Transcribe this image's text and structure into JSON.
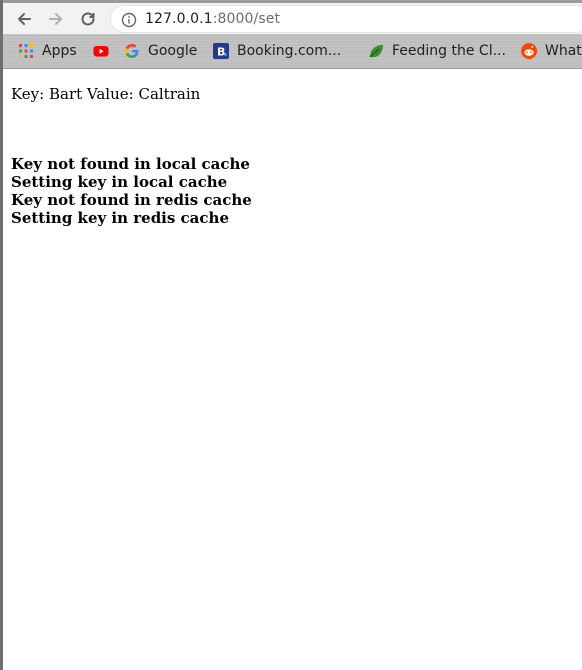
{
  "browser": {
    "url_host": "127.0.0.1",
    "url_rest": ":8000/set"
  },
  "bookmarks": [
    {
      "label": "Apps",
      "icon": "apps-grid-icon"
    },
    {
      "label": "",
      "icon": "youtube-icon"
    },
    {
      "label": "Google",
      "icon": "google-icon"
    },
    {
      "label": "Booking.com...",
      "icon": "booking-icon"
    },
    {
      "label": "Feeding the Cl...",
      "icon": "leaf-icon"
    },
    {
      "label": "What",
      "icon": "reddit-icon"
    }
  ],
  "page": {
    "key_value_line": "Key: Bart Value: Caltrain",
    "messages": [
      "Key not found in local cache",
      "Setting key in local cache",
      "Key not found in redis cache",
      "Setting key in redis cache"
    ]
  },
  "colors": {
    "youtube": "#ff0000",
    "booking": "#243b8c",
    "reddit": "#ff4500",
    "leaf": "#3c8d2f"
  }
}
